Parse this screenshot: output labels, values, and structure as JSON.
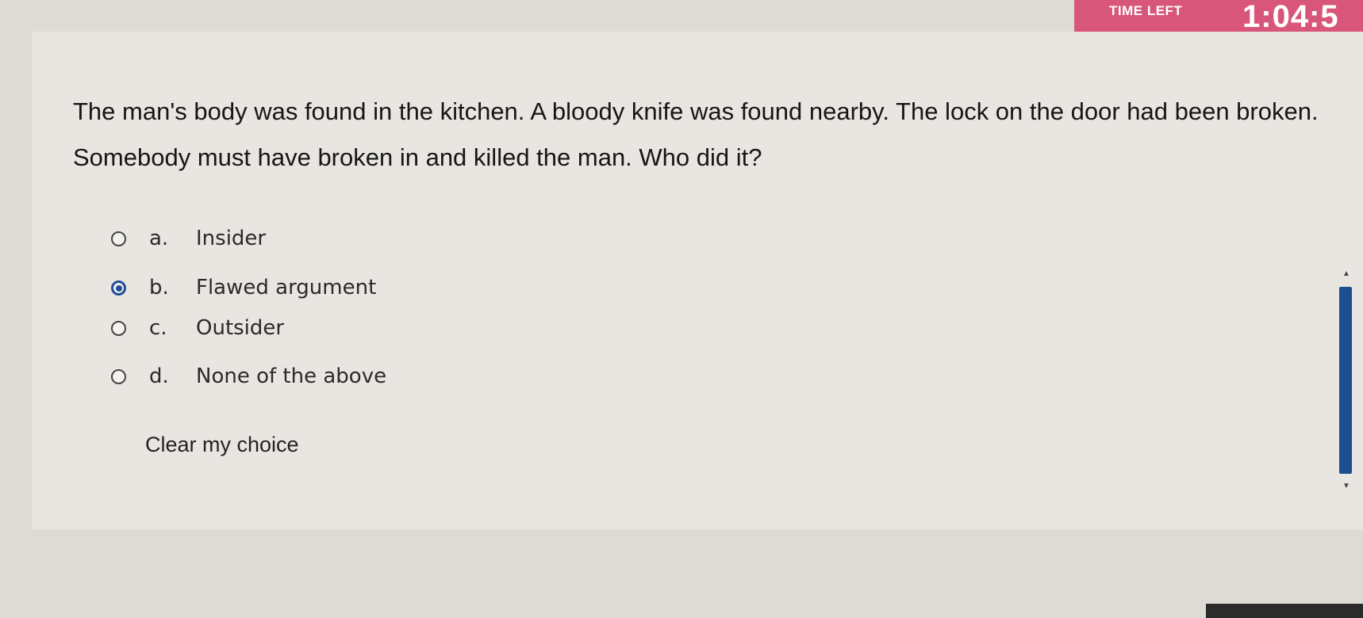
{
  "timer": {
    "label": "TIME LEFT",
    "value": "1:04:5"
  },
  "question": {
    "text": "The man's body was found in the kitchen. A bloody knife was found nearby. The lock on the door had been broken. Somebody must have broken in and killed the man. Who did it?"
  },
  "options": [
    {
      "letter": "a.",
      "text": "Insider",
      "selected": false
    },
    {
      "letter": "b.",
      "text": "Flawed argument",
      "selected": true
    },
    {
      "letter": "c.",
      "text": "Outsider",
      "selected": false
    },
    {
      "letter": "d.",
      "text": "None of the above",
      "selected": false
    }
  ],
  "clear_choice": "Clear my choice",
  "icons": {
    "scroll_up": "caret-up-icon",
    "scroll_down": "caret-down-icon"
  },
  "colors": {
    "timer_bg": "#d9567b",
    "selected_radio": "#1f4e99",
    "scroll_thumb": "#1c4f8f"
  }
}
